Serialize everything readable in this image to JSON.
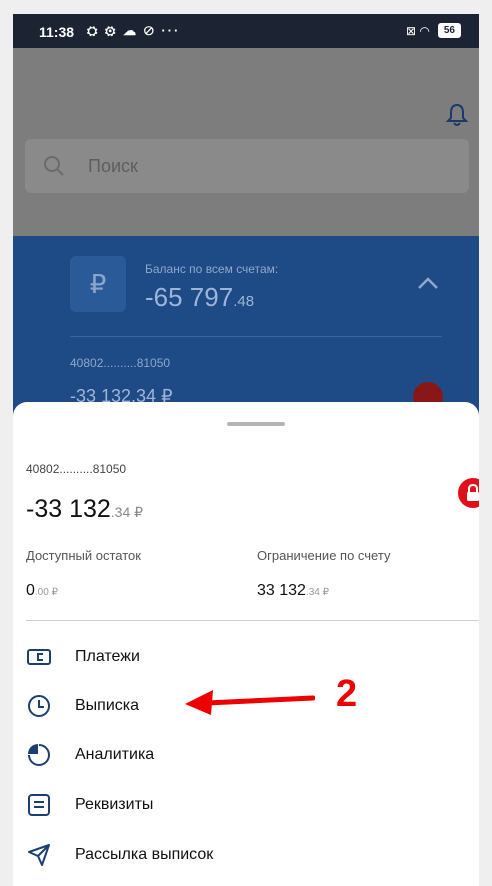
{
  "status_bar": {
    "time": "11:38",
    "left_icons": "⛭ ⚙ ☁ ⊘ ···",
    "right_icons": "⊠ ◠",
    "battery": "56"
  },
  "background": {
    "search_placeholder": "Поиск",
    "balance_label": "Баланс по всем счетам:",
    "balance_main": "-65 797",
    "balance_cents": ".48",
    "currency_symbol": "₽",
    "account_number": "40802..........81050",
    "account_balance": "-33 132,34 ₽"
  },
  "sheet": {
    "account_number": "40802..........81050",
    "balance_main": "-33 132",
    "balance_cents": ".34 ₽",
    "available_label": "Доступный остаток",
    "available_main": "0",
    "available_cents": ".00 ₽",
    "limit_label": "Ограничение по счету",
    "limit_main": "33 132",
    "limit_cents": ".34 ₽",
    "lock_color": "#e0101a"
  },
  "menu": [
    {
      "label": "Платежи",
      "icon": "payment-card-icon"
    },
    {
      "label": "Выписка",
      "icon": "clock-icon"
    },
    {
      "label": "Аналитика",
      "icon": "pie-chart-icon"
    },
    {
      "label": "Реквизиты",
      "icon": "details-lines-icon"
    },
    {
      "label": "Рассылка выписок",
      "icon": "send-plane-icon"
    }
  ],
  "annotation": {
    "number": "2",
    "color": "#ee0000"
  }
}
